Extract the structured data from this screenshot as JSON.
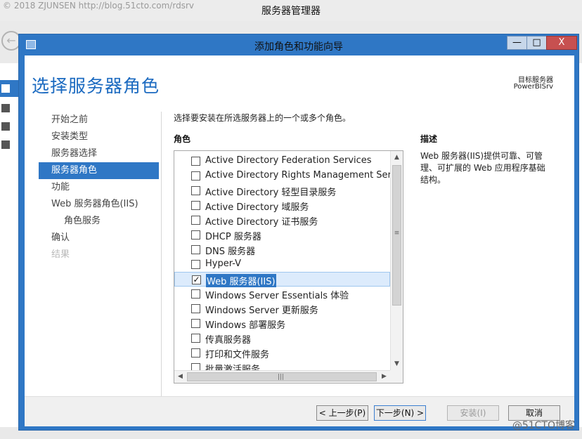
{
  "background": {
    "watermark_top": "© 2018 ZJUNSEN http://blog.51cto.com/rdsrv",
    "window_title": "服务器管理器",
    "watermark_bottom": "@51CTO博客"
  },
  "wizard": {
    "title": "添加角色和功能向导",
    "window_buttons": {
      "minimize": "—",
      "maximize": "□",
      "close": "X"
    },
    "page_title": "选择服务器角色",
    "target_server_label": "目标服务器",
    "target_server_value": "PowerBISrv",
    "nav": [
      {
        "label": "开始之前",
        "state": "normal"
      },
      {
        "label": "安装类型",
        "state": "normal"
      },
      {
        "label": "服务器选择",
        "state": "normal"
      },
      {
        "label": "服务器角色",
        "state": "active"
      },
      {
        "label": "功能",
        "state": "normal"
      },
      {
        "label": "Web 服务器角色(IIS)",
        "state": "normal"
      },
      {
        "label": "角色服务",
        "state": "sub"
      },
      {
        "label": "确认",
        "state": "normal"
      },
      {
        "label": "结果",
        "state": "disabled"
      }
    ],
    "instruction": "选择要安装在所选服务器上的一个或多个角色。",
    "roles_header": "角色",
    "description_header": "描述",
    "description_text": "Web 服务器(IIS)提供可靠、可管理、可扩展的 Web 应用程序基础结构。",
    "roles": [
      {
        "label": "Active Directory Federation Services",
        "checked": false,
        "selected": false
      },
      {
        "label": "Active Directory Rights Management Services",
        "checked": false,
        "selected": false
      },
      {
        "label": "Active Directory 轻型目录服务",
        "checked": false,
        "selected": false
      },
      {
        "label": "Active Directory 域服务",
        "checked": false,
        "selected": false
      },
      {
        "label": "Active Directory 证书服务",
        "checked": false,
        "selected": false
      },
      {
        "label": "DHCP 服务器",
        "checked": false,
        "selected": false
      },
      {
        "label": "DNS 服务器",
        "checked": false,
        "selected": false
      },
      {
        "label": "Hyper-V",
        "checked": false,
        "selected": false
      },
      {
        "label": "Web 服务器(IIS)",
        "checked": true,
        "selected": true
      },
      {
        "label": "Windows Server Essentials 体验",
        "checked": false,
        "selected": false
      },
      {
        "label": "Windows Server 更新服务",
        "checked": false,
        "selected": false
      },
      {
        "label": "Windows 部署服务",
        "checked": false,
        "selected": false
      },
      {
        "label": "传真服务器",
        "checked": false,
        "selected": false
      },
      {
        "label": "打印和文件服务",
        "checked": false,
        "selected": false
      },
      {
        "label": "批量激活服务",
        "checked": false,
        "selected": false
      }
    ],
    "checkmark_glyph": "✓",
    "scroll_glyphs": {
      "up": "▲",
      "down": "▼",
      "left": "◀",
      "right": "▶",
      "v_grip": "≡",
      "h_grip": "|||"
    },
    "buttons": {
      "prev": "< 上一步(P)",
      "next": "下一步(N) >",
      "install": "安装(I)",
      "cancel": "取消"
    }
  }
}
